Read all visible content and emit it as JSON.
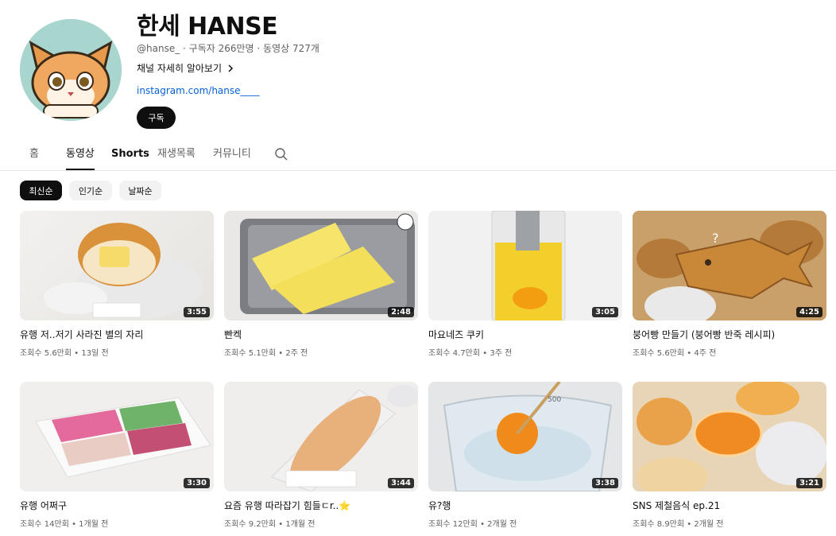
{
  "channel": {
    "name": "한세 HANSE",
    "handle": "@hanse_",
    "subscribers": "구독자 266만명",
    "video_count": "동영상 727개",
    "more_label": "채널 자세히 알아보기",
    "link": "instagram.com/hanse____",
    "subscribe_label": "구독"
  },
  "tabs": [
    {
      "label": "홈"
    },
    {
      "label": "동영상"
    },
    {
      "label": "Shorts"
    },
    {
      "label": "재생목록"
    },
    {
      "label": "커뮤니티"
    }
  ],
  "active_tab": "동영상",
  "chips": [
    {
      "label": "최신순"
    },
    {
      "label": "인기순"
    },
    {
      "label": "날짜순"
    }
  ],
  "videos": [
    {
      "title": "유행 저..저기 사라진 별의 자리",
      "meta": "조회수 5.6만회 • 13일 전",
      "duration": "3:55"
    },
    {
      "title": "빤켁",
      "meta": "조회수 5.1만회 • 2주 전",
      "duration": "2:48"
    },
    {
      "title": "마요네즈 쿠키",
      "meta": "조회수 4.7만회 • 3주 전",
      "duration": "3:05"
    },
    {
      "title": "붕어빵 만들기 (붕어빵 반죽 레시피)",
      "meta": "조회수 5.6만회 • 4주 전",
      "duration": "4:25"
    },
    {
      "title": "유행 어쩌구",
      "meta": "조회수 14만회 • 1개월 전",
      "duration": "3:30"
    },
    {
      "title": "요즘 유행 따라잡기 힘들ㄷr..⭐",
      "meta": "조회수 9.2만회 • 1개월 전",
      "duration": "3:44"
    },
    {
      "title": "유?행",
      "meta": "조회수 12만회 • 2개월 전",
      "duration": "3:38"
    },
    {
      "title": "SNS 제철음식 ep.21",
      "meta": "조회수 8.9만회 • 2개월 전",
      "duration": "3:21"
    }
  ]
}
